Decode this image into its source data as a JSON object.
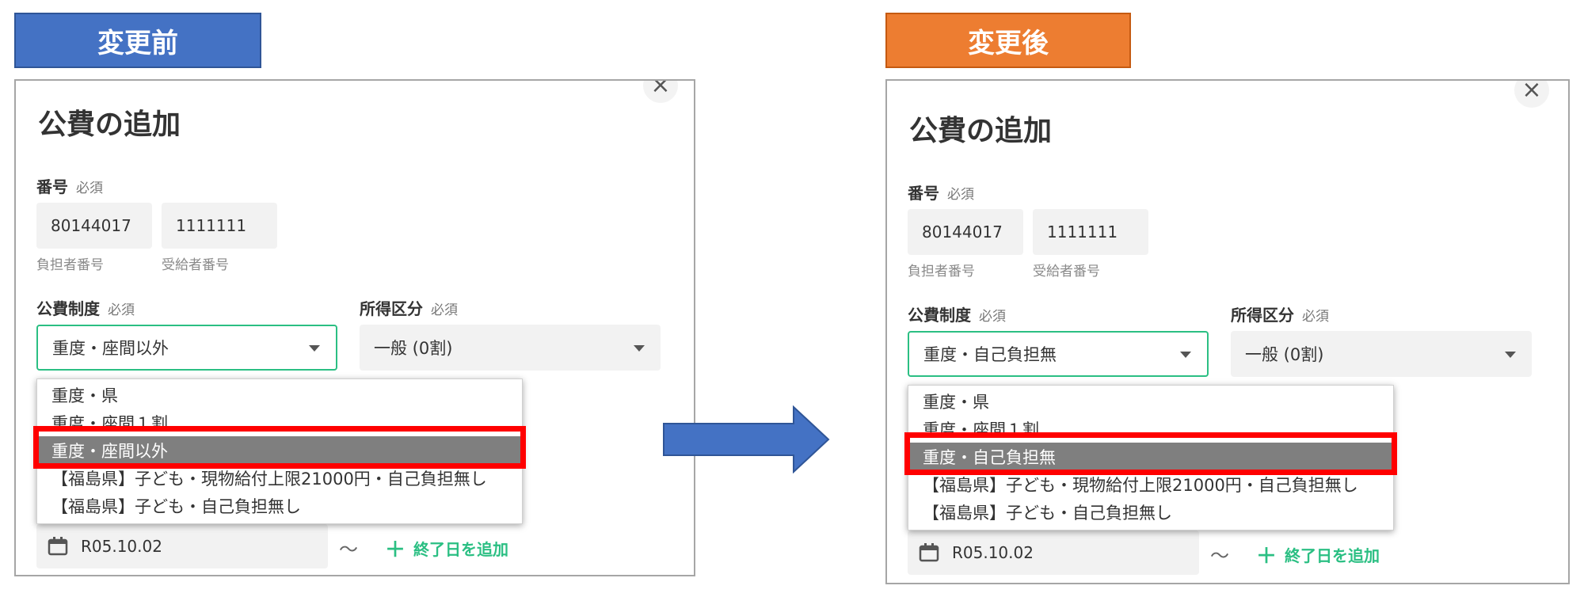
{
  "before": {
    "banner": "変更前",
    "title": "公費の追加",
    "close_glyph": "×",
    "number": {
      "label": "番号",
      "required": "必須",
      "payer_value": "80144017",
      "payer_caption": "負担者番号",
      "recipient_value": "1111111",
      "recipient_caption": "受給者番号"
    },
    "system": {
      "label": "公費制度",
      "required": "必須",
      "value": "重度・座間以外"
    },
    "income": {
      "label": "所得区分",
      "required": "必須",
      "value": "一般 (0割)"
    },
    "dropdown": [
      "重度・県",
      "重度・座間１割",
      "重度・座間以外",
      "【福島県】子ども・現物給付上限21000円・自己負担無し",
      "【福島県】子ども・自己負担無し"
    ],
    "selected_index": 2,
    "start_date": "R05.10.02",
    "tilde": "〜",
    "add_end_plus": "＋",
    "add_end_label": "終了日を追加"
  },
  "after": {
    "banner": "変更後",
    "title": "公費の追加",
    "close_glyph": "×",
    "number": {
      "label": "番号",
      "required": "必須",
      "payer_value": "80144017",
      "payer_caption": "負担者番号",
      "recipient_value": "1111111",
      "recipient_caption": "受給者番号"
    },
    "system": {
      "label": "公費制度",
      "required": "必須",
      "value": "重度・自己負担無"
    },
    "income": {
      "label": "所得区分",
      "required": "必須",
      "value": "一般 (0割)"
    },
    "dropdown": [
      "重度・県",
      "重度・座間１割",
      "重度・自己負担無",
      "【福島県】子ども・現物給付上限21000円・自己負担無し",
      "【福島県】子ども・自己負担無し"
    ],
    "selected_index": 2,
    "start_date": "R05.10.02",
    "tilde": "〜",
    "add_end_plus": "＋",
    "add_end_label": "終了日を追加"
  },
  "colors": {
    "before_banner": "#4472c4",
    "after_banner": "#ed7d31",
    "accent_green": "#2bbf83",
    "highlight_red": "#ff0000",
    "arrow_blue": "#4472c4"
  }
}
